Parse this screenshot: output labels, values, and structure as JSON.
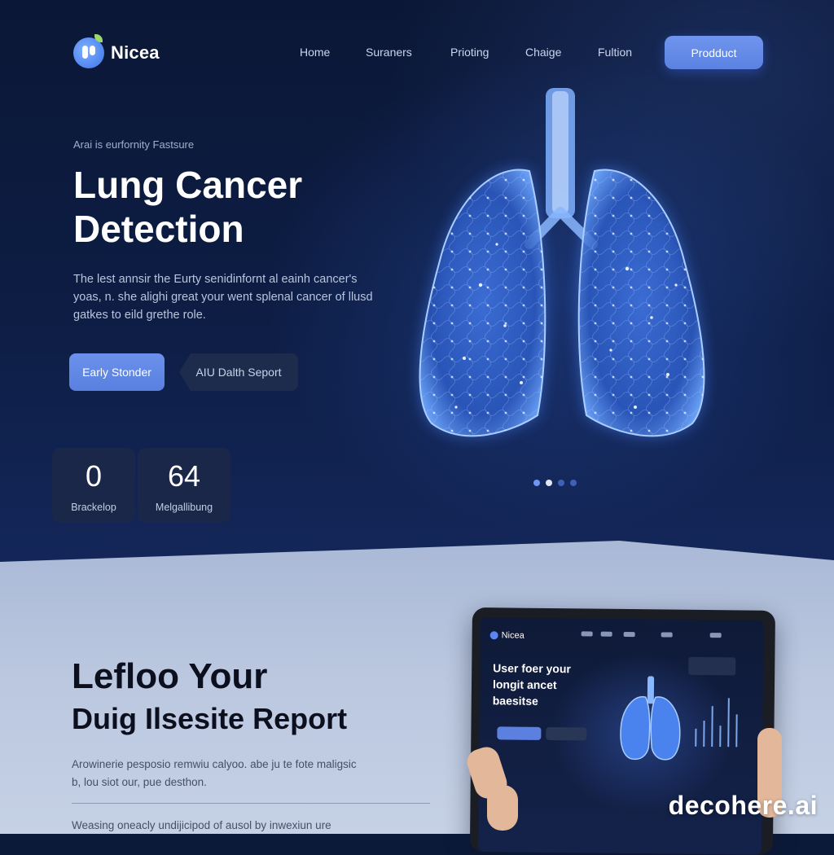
{
  "brand": {
    "name": "Nicea"
  },
  "nav": {
    "items": [
      "Home",
      "Suraners",
      "Prioting",
      "Chaige",
      "Fultion"
    ],
    "cta_label": "Prodduct"
  },
  "hero": {
    "eyebrow": "Arai is eurfornity Fastsure",
    "title_line1": "Lung Cancer",
    "title_line2": "Detection",
    "description": "The lest annsir the Eurty senidinfornt al eainh cancer's yoas, n. she alighi great your went splenal cancer of llusd gatkes to eild grethe role.",
    "primary_button": "Early Stonder",
    "secondary_button": "AIU Dalth Seport",
    "stats": [
      {
        "value": "0",
        "label": "Brackelop"
      },
      {
        "value": "64",
        "label": "Melgallibung"
      }
    ],
    "carousel_dots": 4
  },
  "section2": {
    "title_line1": "Lefloo Your",
    "title_line2": "Duig Ilsesite Report",
    "paragraph": "Arowinerie pesposio remwiu calyoo. abe ju te fote maligsic b, lou siot our, pue desthon.",
    "footer_text": "Weasing oneacly undijicipod of ausol by inwexiun ure"
  },
  "tablet": {
    "logo": "Nicea",
    "headline": "User foer your longit ancet baesitse"
  },
  "watermark": "decohere.ai",
  "colors": {
    "accent": "#5b82e2",
    "hero_bg": "#0d1d44",
    "lower_bg": "#b7c4dd",
    "lung_glow": "#5a9cff"
  }
}
